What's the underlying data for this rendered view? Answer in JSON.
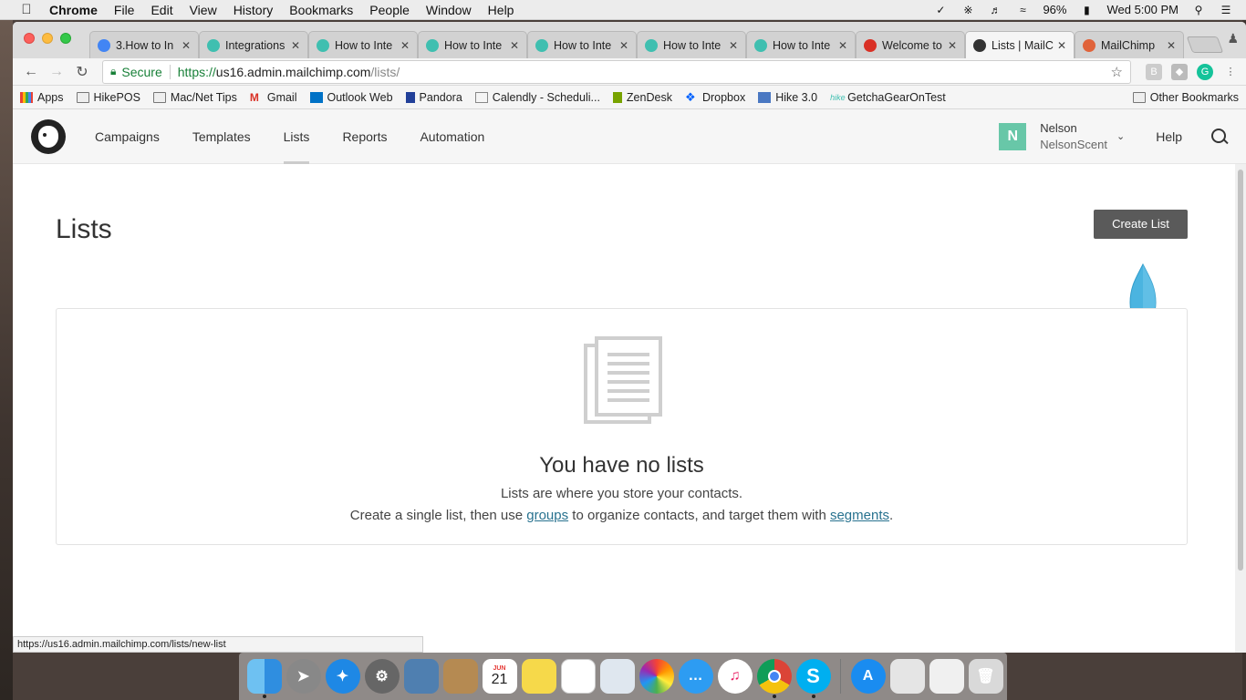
{
  "menubar": {
    "app": "Chrome",
    "items": [
      "File",
      "Edit",
      "View",
      "History",
      "Bookmarks",
      "People",
      "Window",
      "Help"
    ],
    "battery": "96%",
    "clock": "Wed 5:00 PM"
  },
  "tabs": [
    {
      "title": "3.How to In",
      "icon": "google-docs-icon",
      "color": "#4285f4"
    },
    {
      "title": "Integrations",
      "icon": "hike-icon",
      "color": "#3fbfb0"
    },
    {
      "title": "How to Inte",
      "icon": "hike-icon",
      "color": "#3fbfb0"
    },
    {
      "title": "How to Inte",
      "icon": "hike-icon",
      "color": "#3fbfb0"
    },
    {
      "title": "How to Inte",
      "icon": "hike-icon",
      "color": "#3fbfb0"
    },
    {
      "title": "How to Inte",
      "icon": "hike-icon",
      "color": "#3fbfb0"
    },
    {
      "title": "How to Inte",
      "icon": "hike-icon",
      "color": "#3fbfb0"
    },
    {
      "title": "Welcome to",
      "icon": "gmail-icon",
      "color": "#d93025"
    },
    {
      "title": "Lists | MailC",
      "icon": "mailchimp-icon",
      "color": "#333333"
    },
    {
      "title": "MailChimp",
      "icon": "mailchimp-apps-icon",
      "color": "#e0633a"
    }
  ],
  "active_tab_index": 8,
  "address_bar": {
    "secure_label": "Secure",
    "scheme": "https://",
    "host": "us16.admin.mailchimp.com",
    "path": "/lists/"
  },
  "bookmarks": {
    "items": [
      "Apps",
      "HikePOS",
      "Mac/Net Tips",
      "Gmail",
      "Outlook Web",
      "Pandora",
      "Calendly - Scheduli...",
      "ZenDesk",
      "Dropbox",
      "Hike 3.0",
      "GetchaGearOnTest"
    ],
    "other": "Other Bookmarks"
  },
  "mailchimp_nav": {
    "links": [
      "Campaigns",
      "Templates",
      "Lists",
      "Reports",
      "Automation"
    ],
    "active_link": "Lists",
    "avatar_letter": "N",
    "user_name": "Nelson",
    "org_name": "NelsonScent",
    "help": "Help"
  },
  "page": {
    "title": "Lists",
    "create_button": "Create List",
    "empty_title": "You have no lists",
    "empty_line1": "Lists are where you store your contacts.",
    "empty_line2_pre": "Create a single list, then use",
    "empty_link_groups": "groups",
    "empty_line2_mid": "to organize contacts, and target them with",
    "empty_link_segments": "segments",
    "empty_line2_post": "."
  },
  "status_url": "https://us16.admin.mailchimp.com/lists/new-list",
  "dock": {
    "calendar_month": "JUN",
    "calendar_day": "21"
  },
  "colors": {
    "accent_green": "#188038",
    "avatar_bg": "#68c7a8",
    "create_button_bg": "#5a5a5a",
    "link": "#28728f"
  }
}
